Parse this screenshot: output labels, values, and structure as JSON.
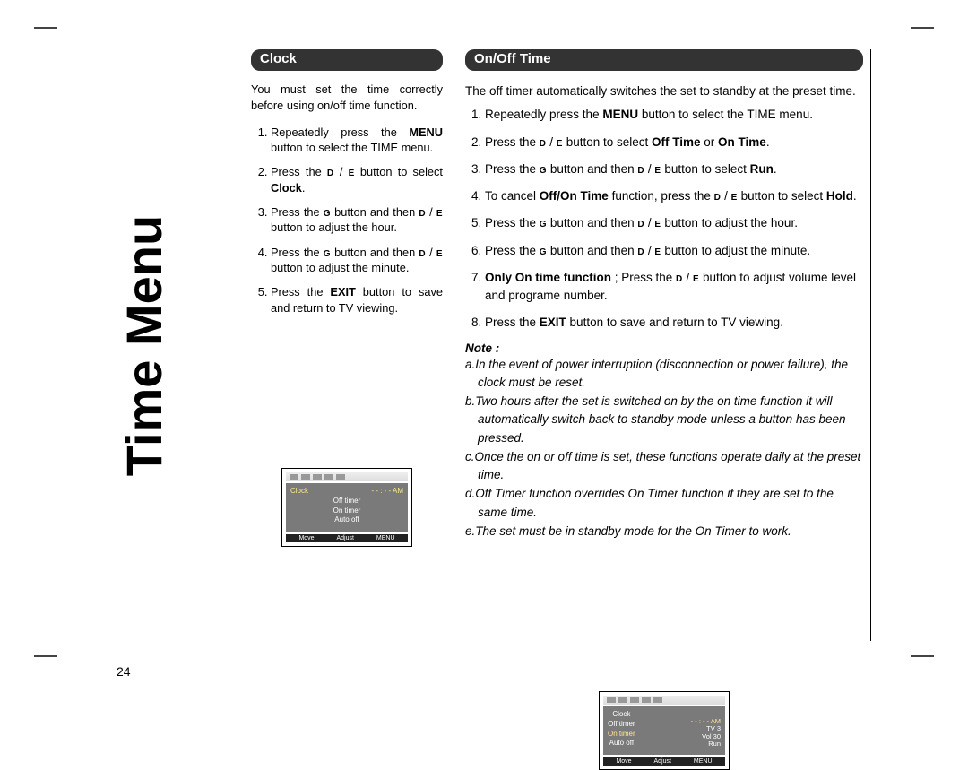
{
  "spine_title": "Time Menu",
  "page_number": "24",
  "clock": {
    "heading": "Clock",
    "intro": "You must set the time correctly before using on/off time function.",
    "steps": {
      "s1a": "Repeatedly press the ",
      "s1b": "MENU",
      "s1c": " button to select the TIME menu.",
      "s2a": "Press the ",
      "s2c": " button to select ",
      "s2d": "Clock",
      "s2e": ".",
      "s3a": "Press the ",
      "s3c": " button and then ",
      "s3e": " button to adjust the hour.",
      "s4a": "Press the ",
      "s4c": " button and then ",
      "s4e": " button to adjust the minute.",
      "s5a": "Press the ",
      "s5b": "EXIT",
      "s5c": " button to save and return to TV viewing."
    }
  },
  "onoff": {
    "heading": "On/Off Time",
    "intro": "The off timer automatically switches the set to standby at the preset time.",
    "steps": {
      "s1a": "Repeatedly press the ",
      "s1b": "MENU",
      "s1c": " button to select the TIME menu.",
      "s2a": "Press the ",
      "s2c": " button to select ",
      "s2d": "Off Time",
      "s2e": " or ",
      "s2f": "On Time",
      "s2g": ".",
      "s3a": "Press the ",
      "s3c": " button and then ",
      "s3e": " button to select ",
      "s3f": "Run",
      "s3g": ".",
      "s4a": "To cancel ",
      "s4b": "Off/On Time",
      "s4c": " function, press the ",
      "s4e": " button to select ",
      "s4f": "Hold",
      "s4g": ".",
      "s5a": "Press the ",
      "s5c": " button and then ",
      "s5e": " button to adjust the hour.",
      "s6a": "Press the ",
      "s6c": " button and then ",
      "s6e": " button to adjust the minute.",
      "s7a": "Only On time function",
      "s7b": " ; Press the ",
      "s7d": " button to adjust volume level and programe number.",
      "s8a": "Press the ",
      "s8b": "EXIT",
      "s8c": " button to save and return to TV viewing."
    },
    "note_label": "Note :",
    "notes": {
      "a": "a.In the event of power interruption (disconnection or power failure), the clock must be reset.",
      "b": "b.Two hours after the set is switched on by the on time function it will automatically switch back to standby mode unless a button has been pressed.",
      "c": "c.Once the on or off time is set, these functions operate daily at the preset time.",
      "d": "d.Off Timer function overrides On Timer function if they are set to the same time.",
      "e": "e.The set must be in standby mode for the On Timer to work."
    }
  },
  "keys": {
    "D": "D",
    "E": "E",
    "G": "G",
    "slash": " / "
  },
  "osd1": {
    "r1a": "Clock",
    "r1b": "- - : - - AM",
    "r2": "Off    timer",
    "r3": "On   timer",
    "r4": "Auto    off",
    "b1": "Move",
    "b2": "Adjust",
    "b3": "MENU"
  },
  "osd2": {
    "r1": "Clock",
    "r2": "Off    timer",
    "r3a": "On   timer",
    "r3b": "- - : - - AM",
    "r4": "Auto    off",
    "tv": "TV    3",
    "vol": "Vol    30",
    "run": "Run",
    "b1": "Move",
    "b2": "Adjust",
    "b3": "MENU"
  }
}
